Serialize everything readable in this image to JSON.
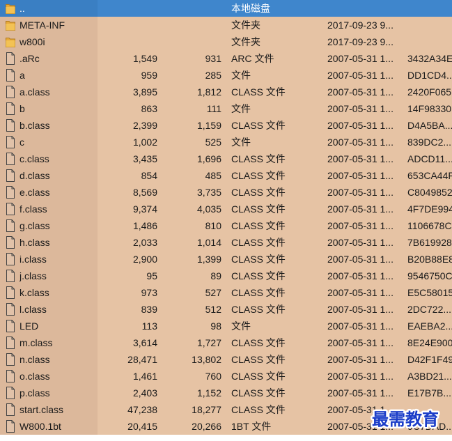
{
  "file_list": {
    "rows": [
      {
        "name": "..",
        "size": "",
        "packed": "",
        "type": "本地磁盘",
        "modified": "",
        "crc": "",
        "icon": "folder-up-icon",
        "selected": true
      },
      {
        "name": "META-INF",
        "size": "",
        "packed": "",
        "type": "文件夹",
        "modified": "2017-09-23 9...",
        "crc": "",
        "icon": "folder-icon"
      },
      {
        "name": "w800i",
        "size": "",
        "packed": "",
        "type": "文件夹",
        "modified": "2017-09-23 9...",
        "crc": "",
        "icon": "folder-icon"
      },
      {
        "name": ".aRc",
        "size": "1,549",
        "packed": "931",
        "type": "ARC 文件",
        "modified": "2007-05-31 1...",
        "crc": "3432A34E",
        "icon": "file-icon"
      },
      {
        "name": "a",
        "size": "959",
        "packed": "285",
        "type": "文件",
        "modified": "2007-05-31 1...",
        "crc": "DD1CD4...",
        "icon": "file-icon"
      },
      {
        "name": "a.class",
        "size": "3,895",
        "packed": "1,812",
        "type": "CLASS 文件",
        "modified": "2007-05-31 1...",
        "crc": "2420F065",
        "icon": "file-icon"
      },
      {
        "name": "b",
        "size": "863",
        "packed": "111",
        "type": "文件",
        "modified": "2007-05-31 1...",
        "crc": "14F98330",
        "icon": "file-icon"
      },
      {
        "name": "b.class",
        "size": "2,399",
        "packed": "1,159",
        "type": "CLASS 文件",
        "modified": "2007-05-31 1...",
        "crc": "D4A5BA...",
        "icon": "file-icon"
      },
      {
        "name": "c",
        "size": "1,002",
        "packed": "525",
        "type": "文件",
        "modified": "2007-05-31 1...",
        "crc": "839DC2...",
        "icon": "file-icon"
      },
      {
        "name": "c.class",
        "size": "3,435",
        "packed": "1,696",
        "type": "CLASS 文件",
        "modified": "2007-05-31 1...",
        "crc": "ADCD11...",
        "icon": "file-icon"
      },
      {
        "name": "d.class",
        "size": "854",
        "packed": "485",
        "type": "CLASS 文件",
        "modified": "2007-05-31 1...",
        "crc": "653CA44F",
        "icon": "file-icon"
      },
      {
        "name": "e.class",
        "size": "8,569",
        "packed": "3,735",
        "type": "CLASS 文件",
        "modified": "2007-05-31 1...",
        "crc": "C8049852",
        "icon": "file-icon"
      },
      {
        "name": "f.class",
        "size": "9,374",
        "packed": "4,035",
        "type": "CLASS 文件",
        "modified": "2007-05-31 1...",
        "crc": "4F7DE994",
        "icon": "file-icon"
      },
      {
        "name": "g.class",
        "size": "1,486",
        "packed": "810",
        "type": "CLASS 文件",
        "modified": "2007-05-31 1...",
        "crc": "1106678C",
        "icon": "file-icon"
      },
      {
        "name": "h.class",
        "size": "2,033",
        "packed": "1,014",
        "type": "CLASS 文件",
        "modified": "2007-05-31 1...",
        "crc": "7B619928",
        "icon": "file-icon"
      },
      {
        "name": "i.class",
        "size": "2,900",
        "packed": "1,399",
        "type": "CLASS 文件",
        "modified": "2007-05-31 1...",
        "crc": "B20B88E8",
        "icon": "file-icon"
      },
      {
        "name": "j.class",
        "size": "95",
        "packed": "89",
        "type": "CLASS 文件",
        "modified": "2007-05-31 1...",
        "crc": "9546750C",
        "icon": "file-icon"
      },
      {
        "name": "k.class",
        "size": "973",
        "packed": "527",
        "type": "CLASS 文件",
        "modified": "2007-05-31 1...",
        "crc": "E5C58015",
        "icon": "file-icon"
      },
      {
        "name": "l.class",
        "size": "839",
        "packed": "512",
        "type": "CLASS 文件",
        "modified": "2007-05-31 1...",
        "crc": "2DC722...",
        "icon": "file-icon"
      },
      {
        "name": "LED",
        "size": "113",
        "packed": "98",
        "type": "文件",
        "modified": "2007-05-31 1...",
        "crc": "EAEBA2...",
        "icon": "file-icon"
      },
      {
        "name": "m.class",
        "size": "3,614",
        "packed": "1,727",
        "type": "CLASS 文件",
        "modified": "2007-05-31 1...",
        "crc": "8E24E900",
        "icon": "file-icon"
      },
      {
        "name": "n.class",
        "size": "28,471",
        "packed": "13,802",
        "type": "CLASS 文件",
        "modified": "2007-05-31 1...",
        "crc": "D42F1F49",
        "icon": "file-icon"
      },
      {
        "name": "o.class",
        "size": "1,461",
        "packed": "760",
        "type": "CLASS 文件",
        "modified": "2007-05-31 1...",
        "crc": "A3BD21...",
        "icon": "file-icon"
      },
      {
        "name": "p.class",
        "size": "2,403",
        "packed": "1,152",
        "type": "CLASS 文件",
        "modified": "2007-05-31 1...",
        "crc": "E17B7B...",
        "icon": "file-icon"
      },
      {
        "name": "start.class",
        "size": "47,238",
        "packed": "18,277",
        "type": "CLASS 文件",
        "modified": "2007-05-31 1...",
        "crc": "",
        "icon": "file-icon"
      },
      {
        "name": "W800.1bt",
        "size": "20,415",
        "packed": "20,266",
        "type": "1BT 文件",
        "modified": "2007-05-31 1...",
        "crc": "9C7DAD...",
        "icon": "file-icon"
      }
    ]
  },
  "watermark": {
    "text": "最需教育",
    "color": "#1a3cc8",
    "icon": "watermark-logo"
  },
  "colors": {
    "row_background": "#e6c3a4",
    "selected_background": "#3f86cc"
  }
}
